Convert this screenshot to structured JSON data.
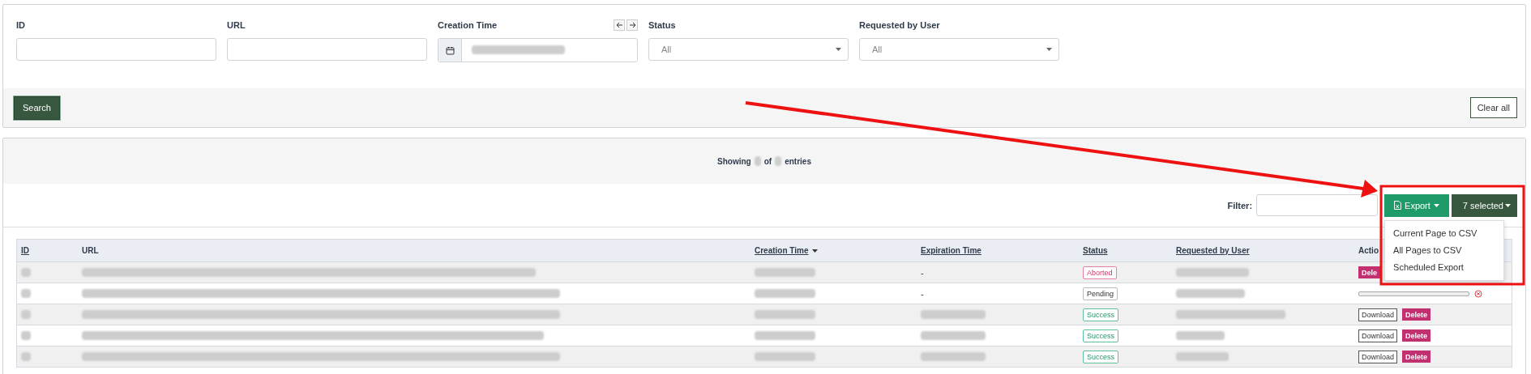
{
  "filters": [
    {
      "kind": "text",
      "label": "ID"
    },
    {
      "kind": "text",
      "label": "URL"
    },
    {
      "kind": "date",
      "label": "Creation Time"
    },
    {
      "kind": "select",
      "label": "Status",
      "value": "All"
    },
    {
      "kind": "select",
      "label": "Requested by User",
      "value": "All"
    }
  ],
  "search_button": "Search",
  "clear_button": "Clear all",
  "summary": {
    "prefix": "Showing",
    "middle": "of",
    "suffix": "entries"
  },
  "filter_label": "Filter:",
  "export": {
    "label": "Export",
    "menu": [
      "Current Page to CSV",
      "All Pages to CSV",
      "Scheduled Export"
    ]
  },
  "selection_button": "7 selected",
  "table": {
    "columns": [
      {
        "label": "ID",
        "sortable": true,
        "sorted": false
      },
      {
        "label": "URL",
        "sortable": false,
        "sorted": false
      },
      {
        "label": "Creation Time",
        "sortable": true,
        "sorted": true
      },
      {
        "label": "Expiration Time",
        "sortable": true,
        "sorted": false
      },
      {
        "label": "Status",
        "sortable": true,
        "sorted": false
      },
      {
        "label": "Requested by User",
        "sortable": true,
        "sorted": false
      },
      {
        "label": "Actio",
        "sortable": false,
        "sorted": false
      }
    ],
    "rows": [
      {
        "expiration": "-",
        "status": {
          "label": "Aborted",
          "kind": "aborted"
        },
        "actions": {
          "kind": "delete",
          "delete": "Dele"
        }
      },
      {
        "expiration": "-",
        "status": {
          "label": "Pending",
          "kind": "pending"
        },
        "actions": {
          "kind": "progress",
          "level": 0
        }
      },
      {
        "status": {
          "label": "Success",
          "kind": "success"
        },
        "actions": {
          "kind": "files",
          "download": "Download",
          "delete": "Delete"
        }
      },
      {
        "status": {
          "label": "Success",
          "kind": "success"
        },
        "actions": {
          "kind": "files",
          "download": "Download",
          "delete": "Delete"
        }
      },
      {
        "status": {
          "label": "Success",
          "kind": "success"
        },
        "actions": {
          "kind": "files",
          "download": "Download",
          "delete": "Delete"
        }
      }
    ]
  }
}
